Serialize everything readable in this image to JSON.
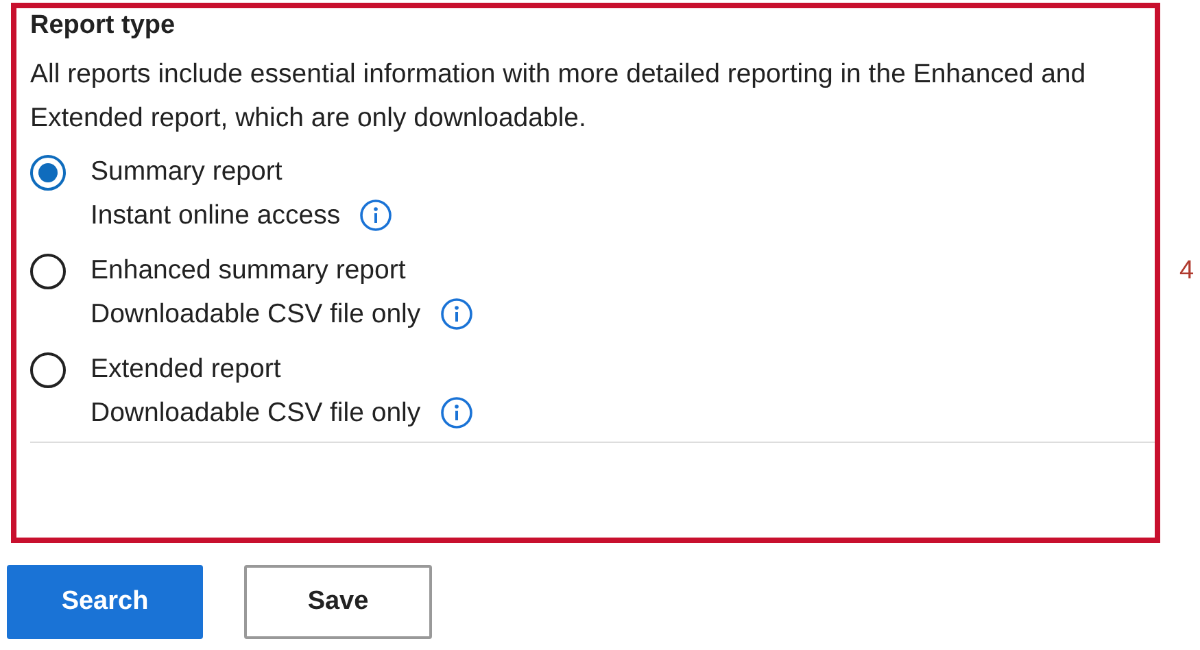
{
  "section": {
    "title": "Report type",
    "description": "All reports include essential information with more detailed reporting in the Enhanced and Extended report, which are only downloadable.",
    "options": [
      {
        "label": "Summary report",
        "detail": "Instant online access",
        "selected": true
      },
      {
        "label": "Enhanced summary report",
        "detail": "Downloadable CSV file only",
        "selected": false
      },
      {
        "label": "Extended report",
        "detail": "Downloadable CSV file only",
        "selected": false
      }
    ]
  },
  "callout": "4",
  "buttons": [
    {
      "label": "Search",
      "kind": "primary"
    },
    {
      "label": "Save",
      "kind": "secondary"
    }
  ]
}
